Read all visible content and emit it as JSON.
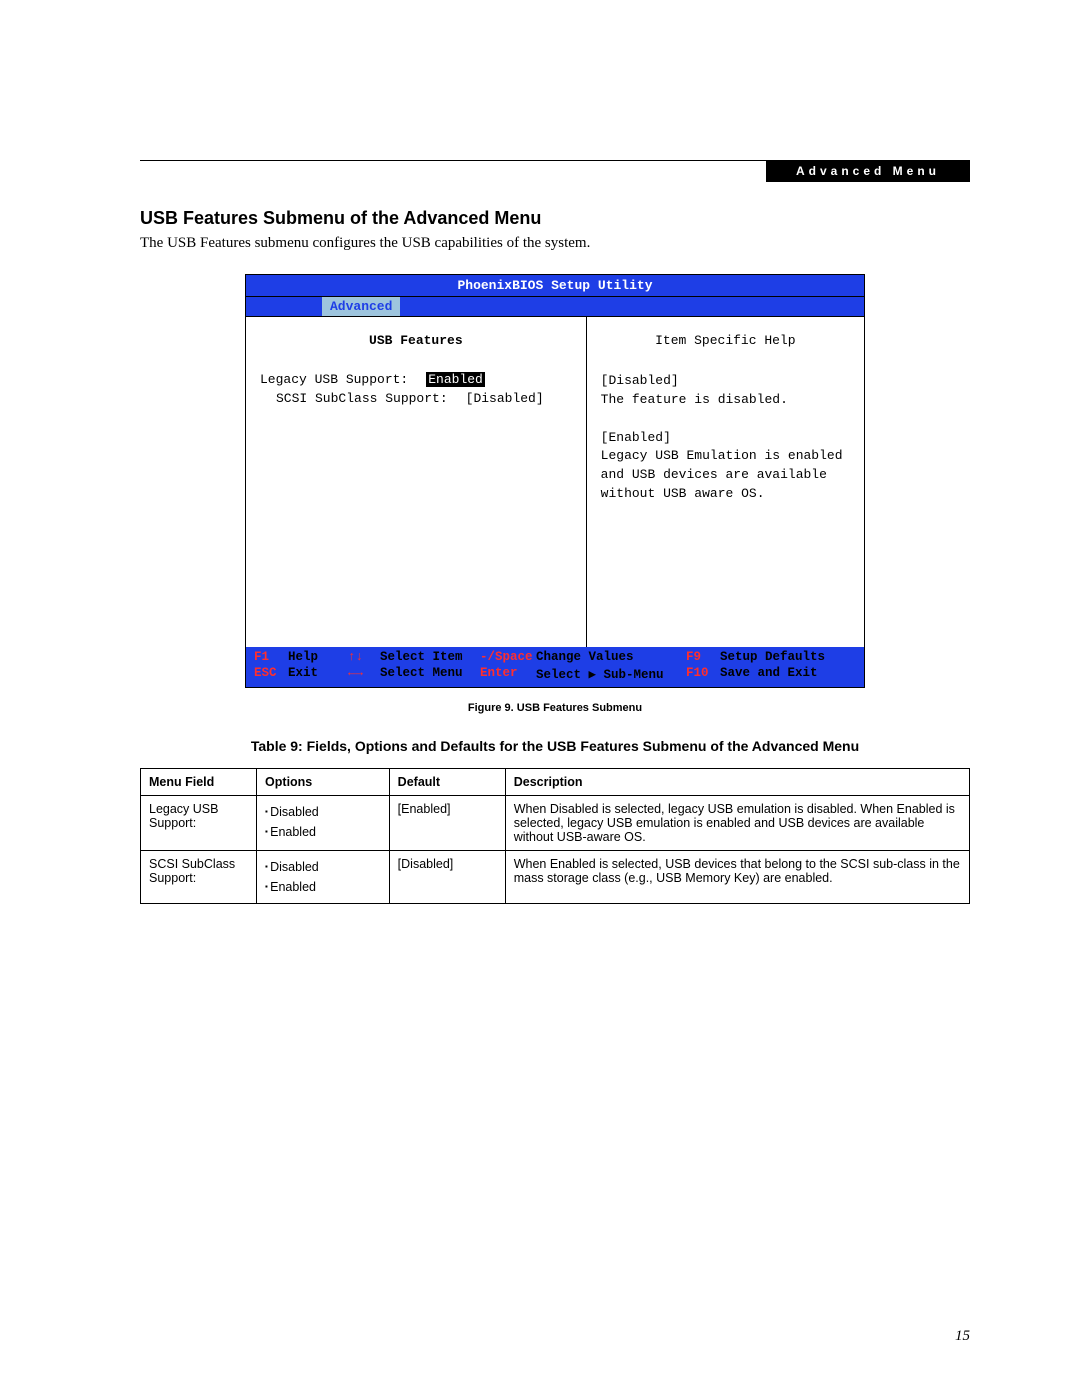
{
  "header": {
    "band_label": "Advanced Menu"
  },
  "section": {
    "title": "USB Features Submenu of the Advanced Menu",
    "intro": "The USB Features submenu configures the USB capabilities of the system."
  },
  "bios": {
    "title": "PhoenixBIOS Setup Utility",
    "tab": "Advanced",
    "left_title": "USB Features",
    "fields": [
      {
        "label": "Legacy USB Support:",
        "value": "Enabled",
        "selected": true
      },
      {
        "label": "SCSI SubClass Support:",
        "value": "[Disabled]",
        "selected": false
      }
    ],
    "help_title": "Item Specific Help",
    "help_text": "[Disabled]\nThe feature is disabled.\n\n[Enabled]\nLegacy USB Emulation is enabled and USB devices are available without USB aware OS.",
    "footer": {
      "f1_key": "F1",
      "f1_label": "Help",
      "arrows_v": "↑↓",
      "select_item": "Select Item",
      "minus_space": "-/Space",
      "change_values": "Change Values",
      "f9_key": "F9",
      "setup_defaults": "Setup Defaults",
      "esc_key": "ESC",
      "exit_label": "Exit",
      "arrows_h": "←→",
      "select_menu": "Select Menu",
      "enter_key": "Enter",
      "select_sub": "Select ▶ Sub-Menu",
      "f10_key": "F10",
      "save_exit": "Save and Exit"
    }
  },
  "figure_caption": "Figure 9.  USB Features Submenu",
  "table_title": "Table 9: Fields, Options and Defaults for the USB Features Submenu of the Advanced Menu",
  "table": {
    "headers": {
      "c0": "Menu Field",
      "c1": "Options",
      "c2": "Default",
      "c3": "Description"
    },
    "rows": [
      {
        "field": "Legacy USB Support:",
        "options": [
          "Disabled",
          "Enabled"
        ],
        "default": "[Enabled]",
        "desc": "When Disabled is selected, legacy USB emulation is disabled. When Enabled is selected, legacy USB emulation is enabled and USB devices are available without USB-aware OS."
      },
      {
        "field": "SCSI SubClass Support:",
        "options": [
          "Disabled",
          "Enabled"
        ],
        "default": "[Disabled]",
        "desc": "When Enabled is selected, USB devices that belong to the SCSI sub-class in the mass storage class (e.g., USB Memory Key) are enabled."
      }
    ]
  },
  "page_number": "15"
}
